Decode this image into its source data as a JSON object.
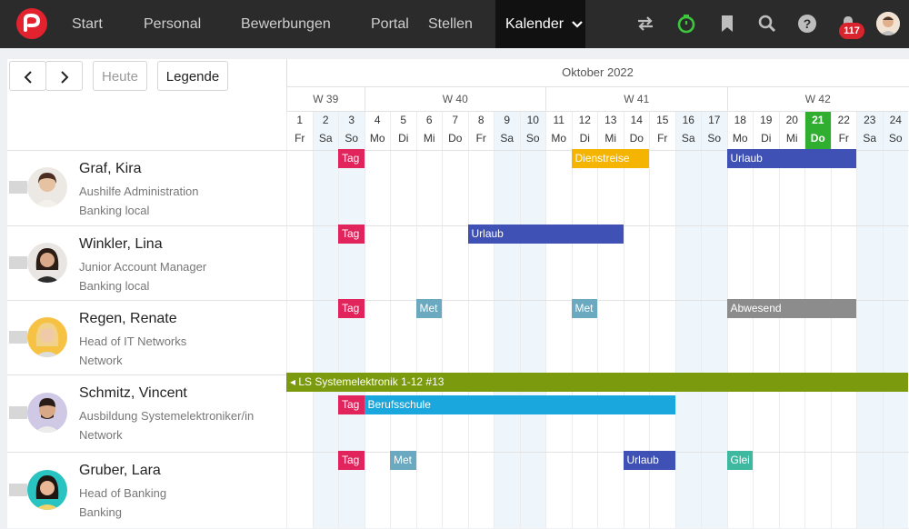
{
  "nav": {
    "items": [
      "Start",
      "Personal",
      "Bewerbungen",
      "Portal",
      "Stellen",
      "Kalender"
    ],
    "notification_count": "117"
  },
  "toolbar": {
    "prev_label": "‹",
    "next_label": "›",
    "today_label": "Heute",
    "legend_label": "Legende"
  },
  "calendar": {
    "month": "Oktober 2022",
    "weeks": [
      "W 39",
      "W 40",
      "W 41",
      "W 42"
    ],
    "days": [
      {
        "n": "1",
        "d": "Fr"
      },
      {
        "n": "2",
        "d": "Sa"
      },
      {
        "n": "3",
        "d": "So"
      },
      {
        "n": "4",
        "d": "Mo"
      },
      {
        "n": "5",
        "d": "Di"
      },
      {
        "n": "6",
        "d": "Mi"
      },
      {
        "n": "7",
        "d": "Do"
      },
      {
        "n": "8",
        "d": "Fr"
      },
      {
        "n": "9",
        "d": "Sa"
      },
      {
        "n": "10",
        "d": "So"
      },
      {
        "n": "11",
        "d": "Mo"
      },
      {
        "n": "12",
        "d": "Di"
      },
      {
        "n": "13",
        "d": "Mi"
      },
      {
        "n": "14",
        "d": "Do"
      },
      {
        "n": "15",
        "d": "Fr"
      },
      {
        "n": "16",
        "d": "Sa"
      },
      {
        "n": "17",
        "d": "So"
      },
      {
        "n": "18",
        "d": "Mo"
      },
      {
        "n": "19",
        "d": "Di"
      },
      {
        "n": "20",
        "d": "Mi"
      },
      {
        "n": "21",
        "d": "Do"
      },
      {
        "n": "22",
        "d": "Fr"
      },
      {
        "n": "23",
        "d": "Sa"
      },
      {
        "n": "24",
        "d": "So"
      }
    ],
    "today": "21"
  },
  "people": [
    {
      "name": "Graf, Kira",
      "role": "Aushilfe Administration",
      "location": "Banking local"
    },
    {
      "name": "Winkler, Lina",
      "role": "Junior Account Manager",
      "location": "Banking local"
    },
    {
      "name": "Regen, Renate",
      "role": "Head of IT Networks",
      "location": "Network"
    },
    {
      "name": "Schmitz, Vincent",
      "role": "Ausbildung Systemelektroniker/in",
      "location": "Network"
    },
    {
      "name": "Gruber, Lara",
      "role": "Head of Banking",
      "location": "Banking"
    }
  ],
  "events": [
    {
      "row": 0,
      "start": "3",
      "end": "3",
      "label": "Tag",
      "color": "#e2245c"
    },
    {
      "row": 0,
      "start": "12",
      "end": "14",
      "label": "Dienstreise",
      "color": "#f4b400"
    },
    {
      "row": 0,
      "start": "18",
      "end": "22",
      "label": "Urlaub",
      "color": "#3f51b5"
    },
    {
      "row": 1,
      "start": "3",
      "end": "3",
      "label": "Tag",
      "color": "#e2245c"
    },
    {
      "row": 1,
      "start": "8",
      "end": "13",
      "label": "Urlaub",
      "color": "#3f51b5"
    },
    {
      "row": 2,
      "start": "3",
      "end": "3",
      "label": "Tag",
      "color": "#e2245c"
    },
    {
      "row": 2,
      "start": "6",
      "end": "6",
      "label": "Met",
      "color": "#6aa9bf"
    },
    {
      "row": 2,
      "start": "12",
      "end": "12",
      "label": "Met",
      "color": "#6aa9bf"
    },
    {
      "row": 2,
      "start": "18",
      "end": "22",
      "label": "Abwesend",
      "color": "#8c8c8c"
    },
    {
      "row": 3,
      "start": "1",
      "end": "24",
      "label": "◂ LS Systemelektronik 1-12 #13",
      "color": "#7b9a0e",
      "lane": 0
    },
    {
      "row": 3,
      "start": "3",
      "end": "3",
      "label": "Tag",
      "color": "#e2245c",
      "lane": 1
    },
    {
      "row": 3,
      "start": "4",
      "end": "15",
      "label": "Berufsschule",
      "color": "#1aa7dd",
      "lane": 1
    },
    {
      "row": 4,
      "start": "3",
      "end": "3",
      "label": "Tag",
      "color": "#e2245c"
    },
    {
      "row": 4,
      "start": "5",
      "end": "5",
      "label": "Met",
      "color": "#6aa9bf"
    },
    {
      "row": 4,
      "start": "14",
      "end": "15",
      "label": "Urlaub",
      "color": "#3f51b5"
    },
    {
      "row": 4,
      "start": "18",
      "end": "18",
      "label": "Glei",
      "color": "#3fb8a0"
    }
  ]
}
